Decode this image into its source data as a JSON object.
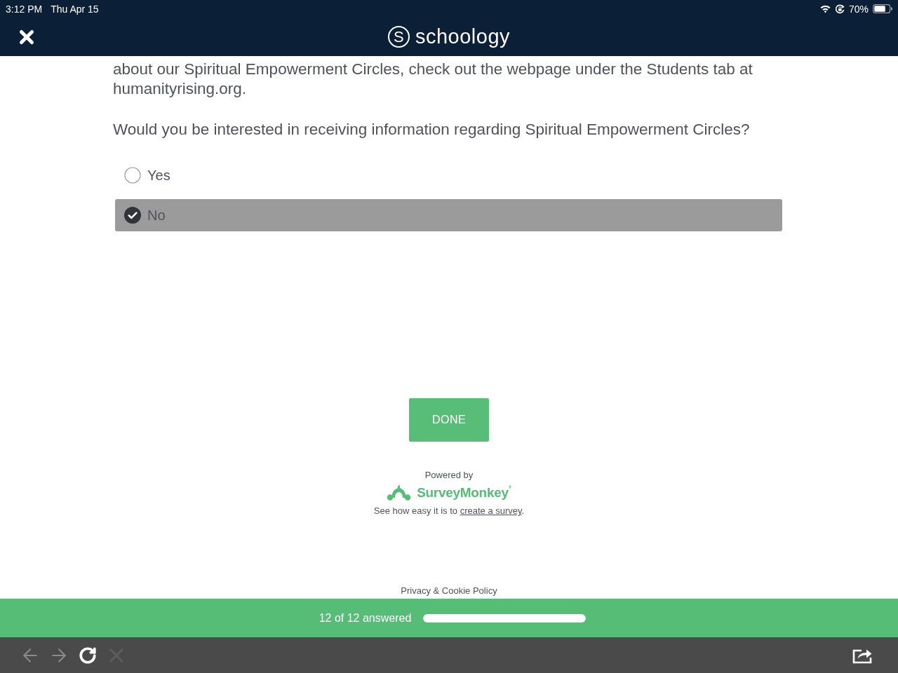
{
  "status_bar": {
    "time": "3:12 PM",
    "date": "Thu Apr 15",
    "battery": "70%"
  },
  "header": {
    "logo_mark": "S",
    "logo_text": "schoology"
  },
  "survey": {
    "intro": "about our Spiritual Empowerment Circles, check out the webpage under the Students tab at humanityrising.org.",
    "question": "Would you be interested in receiving information regarding Spiritual Empowerment Circles?",
    "options": [
      {
        "label": "Yes",
        "selected": false
      },
      {
        "label": "No",
        "selected": true
      }
    ],
    "done_button": "DONE"
  },
  "footer": {
    "powered_by": "Powered by",
    "brand": "SurveyMonkey$^{®}$",
    "tagline": "See how easy it is to",
    "link": "create a survey",
    "tagline_end": ".",
    "privacy": "Privacy & Cookie Policy"
  },
  "progress": {
    "label": "12 of 12 answered",
    "level": 1
  },
  "browser_toolbar": {
    "buttons": [
      {
        "kind": "back",
        "disabled": true
      },
      {
        "kind": "forward",
        "disabled": true
      },
      {
        "kind": "reload",
        "disabled": false
      },
      {
        "kind": "stop",
        "disabled": true
      },
      {
        "kind": "share",
        "disabled": false
      }
    ]
  }
}
